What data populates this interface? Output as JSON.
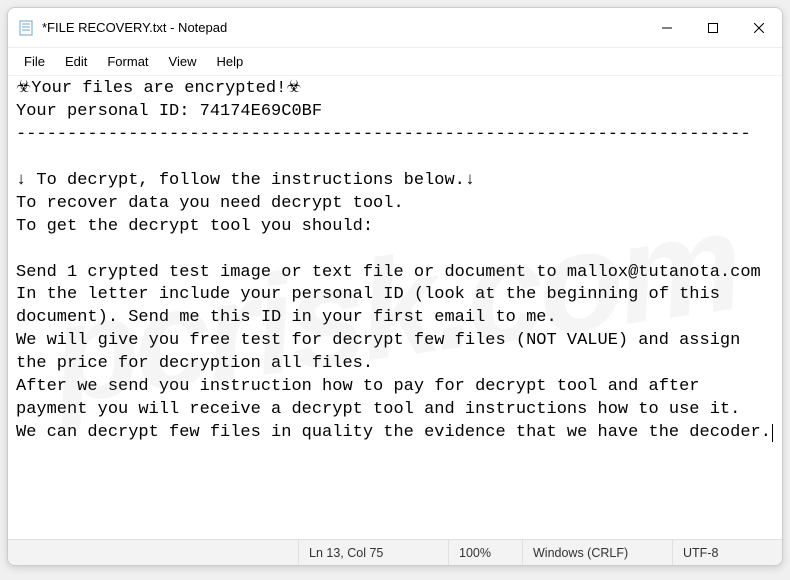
{
  "titlebar": {
    "title": "*FILE RECOVERY.txt - Notepad"
  },
  "menubar": {
    "items": [
      "File",
      "Edit",
      "Format",
      "View",
      "Help"
    ]
  },
  "content": {
    "line1": "☣Your files are encrypted!☣",
    "line2": "Your personal ID: 74174E69C0BF",
    "line3": "------------------------------------------------------------------------",
    "line4": "",
    "line5": "↓ To decrypt, follow the instructions below.↓",
    "line6": "To recover data you need decrypt tool.",
    "line7": "To get the decrypt tool you should:",
    "line8": "",
    "line9": "Send 1 crypted test image or text file or document to mallox@tutanota.com",
    "line10": "In the letter include your personal ID (look at the beginning of this document). Send me this ID in your first email to me.",
    "line11": "We will give you free test for decrypt few files (NOT VALUE) and assign the price for decryption all files.",
    "line12": "After we send you instruction how to pay for decrypt tool and after payment you will receive a decrypt tool and instructions how to use it.",
    "line13": "We can decrypt few files in quality the evidence that we have the decoder."
  },
  "statusbar": {
    "position": "Ln 13, Col 75",
    "zoom": "100%",
    "eol": "Windows (CRLF)",
    "encoding": "UTF-8"
  },
  "watermark": {
    "text": "pcrisk.com"
  }
}
